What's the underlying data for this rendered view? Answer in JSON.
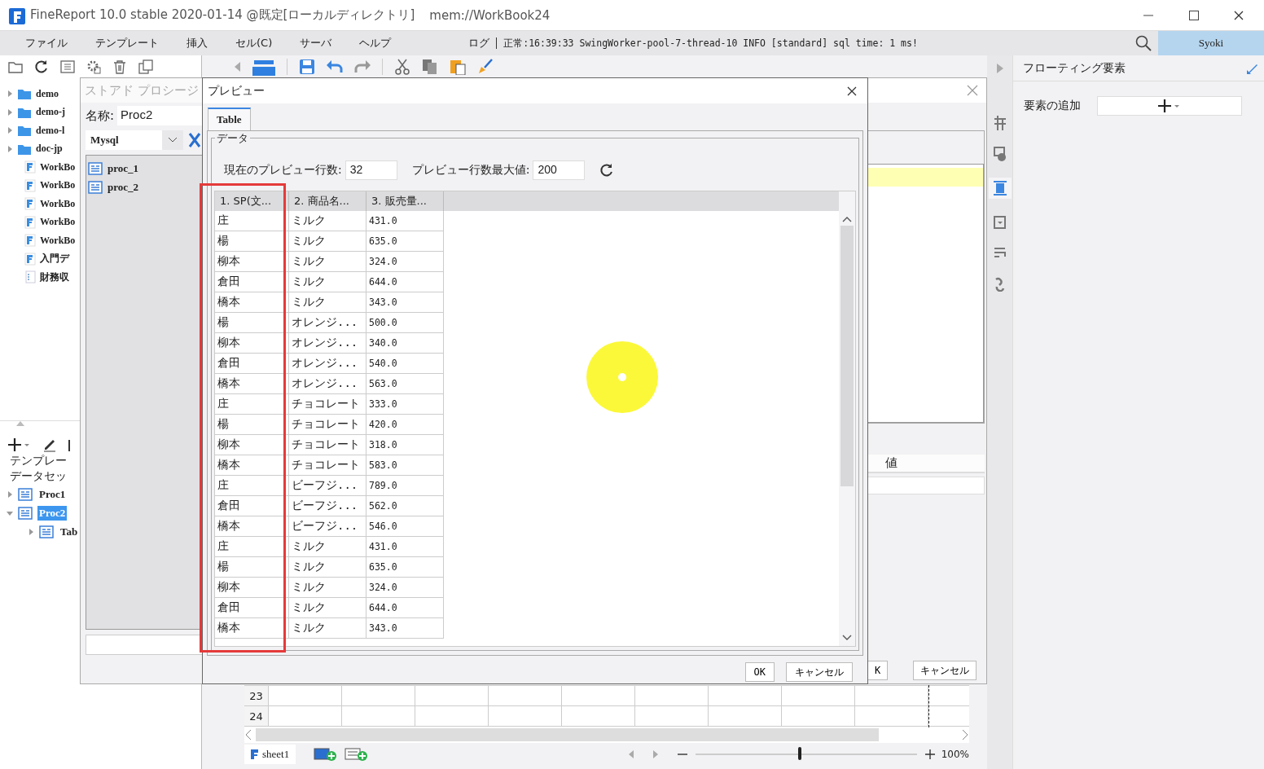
{
  "window": {
    "title": "FineReport 10.0 stable 2020-01-14 @既定[ローカルディレクトリ]",
    "document": "mem://WorkBook24"
  },
  "menu": [
    "ファイル",
    "テンプレート",
    "挿入",
    "セル(C)",
    "サーバ",
    "ヘルプ"
  ],
  "log": {
    "label": "ログ",
    "entry": "正常:16:39:33 SwingWorker-pool-7-thread-10 INFO [standard] sql time: 1 ms!"
  },
  "user": "Syoki",
  "file_tree": [
    {
      "label": "demo",
      "kind": "folder"
    },
    {
      "label": "demo-j",
      "kind": "folder"
    },
    {
      "label": "demo-l",
      "kind": "folder"
    },
    {
      "label": "doc-jp",
      "kind": "folder"
    },
    {
      "label": "WorkBo",
      "kind": "report"
    },
    {
      "label": "WorkBo",
      "kind": "report"
    },
    {
      "label": "WorkBo",
      "kind": "report"
    },
    {
      "label": "WorkBo",
      "kind": "report"
    },
    {
      "label": "WorkBo",
      "kind": "report"
    },
    {
      "label": "入門デ",
      "kind": "report"
    },
    {
      "label": "財務収",
      "kind": "form"
    }
  ],
  "dataset_panel": {
    "sections": [
      "テンプレー",
      "データセッ"
    ],
    "tree": [
      {
        "label": "Proc1",
        "selected": false,
        "expanded": false
      },
      {
        "label": "Proc2",
        "selected": true,
        "expanded": true,
        "children": [
          {
            "label": "Tab",
            "selected": false,
            "expanded": false
          }
        ]
      }
    ]
  },
  "sheet": {
    "rows": [
      "23",
      "24"
    ],
    "tab": "sheet1",
    "zoom": "100%",
    "level": 0.47
  },
  "floating_panel": {
    "title": "フローティング要素",
    "add_label": "要素の追加"
  },
  "procedure_dialog": {
    "title": "ストアド プロシージ",
    "name_label": "名称:",
    "name": "Proc2",
    "connection": "Mysql",
    "procedures": [
      "proc_1",
      "proc_2"
    ],
    "value_header": "値",
    "buttons": [
      "K",
      "キャンセル"
    ]
  },
  "preview_dialog": {
    "title": "プレビュー",
    "tabs": [
      {
        "label": "Table",
        "selected": true
      }
    ],
    "group": "データ",
    "current_label": "現在のプレビュー行数:",
    "current": "32",
    "max_label": "プレビュー行数最大値:",
    "max": "200",
    "columns": [
      "1. SP(文...",
      "2. 商品名...",
      "3. 販売量..."
    ],
    "rows": [
      [
        "庄",
        "ミルク",
        "431.0"
      ],
      [
        "楊",
        "ミルク",
        "635.0"
      ],
      [
        "柳本",
        "ミルク",
        "324.0"
      ],
      [
        "倉田",
        "ミルク",
        "644.0"
      ],
      [
        "橋本",
        "ミルク",
        "343.0"
      ],
      [
        "楊",
        "オレンジ...",
        "500.0"
      ],
      [
        "柳本",
        "オレンジ...",
        "340.0"
      ],
      [
        "倉田",
        "オレンジ...",
        "540.0"
      ],
      [
        "橋本",
        "オレンジ...",
        "563.0"
      ],
      [
        "庄",
        "チョコレート",
        "333.0"
      ],
      [
        "楊",
        "チョコレート",
        "420.0"
      ],
      [
        "柳本",
        "チョコレート",
        "318.0"
      ],
      [
        "橋本",
        "チョコレート",
        "583.0"
      ],
      [
        "庄",
        "ビーフジ...",
        "789.0"
      ],
      [
        "倉田",
        "ビーフジ...",
        "562.0"
      ],
      [
        "橋本",
        "ビーフジ...",
        "546.0"
      ],
      [
        "庄",
        "ミルク",
        "431.0"
      ],
      [
        "楊",
        "ミルク",
        "635.0"
      ],
      [
        "柳本",
        "ミルク",
        "324.0"
      ],
      [
        "倉田",
        "ミルク",
        "644.0"
      ],
      [
        "橋本",
        "ミルク",
        "343.0"
      ]
    ],
    "buttons": [
      "OK",
      "キャンセル"
    ]
  }
}
